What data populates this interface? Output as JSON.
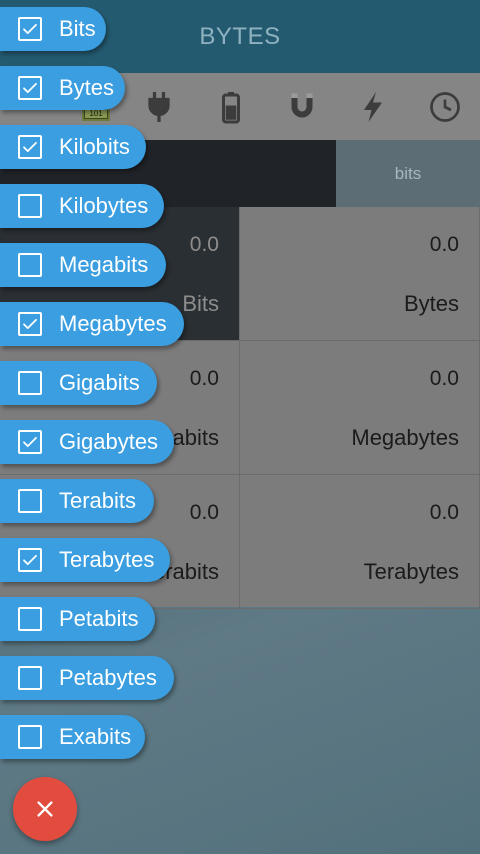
{
  "header": {
    "title": "BYTES"
  },
  "category_bar": {
    "icons": [
      "binary-icon",
      "plug-icon",
      "battery-icon",
      "magnet-icon",
      "lightning-icon",
      "clock-icon"
    ],
    "active_label": "101"
  },
  "unit_header": {
    "right_label": "bits"
  },
  "grid": {
    "cells": [
      {
        "value": "0.0",
        "unit": "Bits"
      },
      {
        "value": "0.0",
        "unit": "Bytes"
      },
      {
        "value": "0.0",
        "unit": "Megabits"
      },
      {
        "value": "0.0",
        "unit": "Megabytes"
      },
      {
        "value": "0.0",
        "unit": "Terabits"
      },
      {
        "value": "0.0",
        "unit": "Terabytes"
      }
    ]
  },
  "unit_filter": {
    "items": [
      {
        "label": "Bits",
        "checked": true
      },
      {
        "label": "Bytes",
        "checked": true
      },
      {
        "label": "Kilobits",
        "checked": true
      },
      {
        "label": "Kilobytes",
        "checked": false
      },
      {
        "label": "Megabits",
        "checked": false
      },
      {
        "label": "Megabytes",
        "checked": true
      },
      {
        "label": "Gigabits",
        "checked": false
      },
      {
        "label": "Gigabytes",
        "checked": true
      },
      {
        "label": "Terabits",
        "checked": false
      },
      {
        "label": "Terabytes",
        "checked": true
      },
      {
        "label": "Petabits",
        "checked": false
      },
      {
        "label": "Petabytes",
        "checked": false
      },
      {
        "label": "Exabits",
        "checked": false
      }
    ]
  },
  "fab": {
    "icon": "close-icon"
  },
  "colors": {
    "header": "#245a70",
    "pill": "#3a9ee0",
    "fab": "#e24c3f",
    "selected_cell": "#2a2f33"
  }
}
